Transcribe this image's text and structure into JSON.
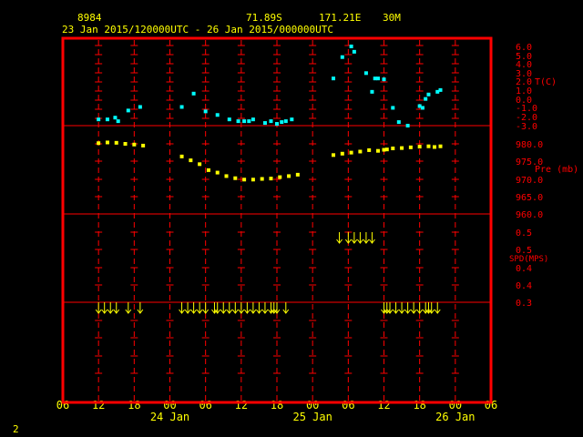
{
  "header": {
    "station_id": "8984",
    "latitude": "71.89S",
    "longitude": "171.21E",
    "elevation": "30M",
    "period": "23 Jan 2015/120000UTC - 26 Jan 2015/000000UTC"
  },
  "page_number": "2",
  "colors": {
    "background": "#000000",
    "frame": "#ff0000",
    "grid": "#ff0000",
    "header_text": "#ffff00",
    "temperature": "#00ffff",
    "pressure": "#ffff00",
    "wind": "#ffff00"
  },
  "chart_data": [
    {
      "type": "scatter",
      "ylabel": "T(C)",
      "ylim": [
        -3.0,
        6.0
      ],
      "yticks": [
        "6.0",
        "5.0",
        "4.0",
        "3.0",
        "2.0",
        "1.0",
        "0.0",
        "-1.0",
        "-2.0",
        "-3.0"
      ],
      "ytick_values": [
        6,
        5,
        4,
        3,
        2,
        1,
        0,
        -1,
        -2,
        -3
      ],
      "series": [
        {
          "x": [
            12,
            13.5,
            14.8,
            15.3,
            17,
            19,
            26,
            28,
            30,
            32,
            34,
            35.5,
            36.5,
            37.3,
            38,
            40,
            41,
            42,
            42.8,
            43.5,
            44.5,
            51.5,
            53,
            54.5,
            55,
            57,
            58,
            58.5,
            59,
            60,
            61.5,
            62.5,
            64,
            66,
            66.5,
            67,
            67.5,
            69,
            69.5
          ],
          "y": [
            -2.3,
            -2.3,
            -2.1,
            -2.5,
            -1.3,
            -0.9,
            -0.9,
            0.6,
            -1.4,
            -1.8,
            -2.3,
            -2.5,
            -2.5,
            -2.5,
            -2.3,
            -2.7,
            -2.5,
            -2.8,
            -2.6,
            -2.5,
            -2.3,
            2.3,
            4.7,
            5.9,
            5.3,
            2.9,
            0.8,
            2.3,
            2.3,
            2.2,
            -1.0,
            -2.6,
            -3.0,
            -0.8,
            -1.0,
            0.0,
            0.5,
            0.8,
            1.0
          ]
        }
      ]
    },
    {
      "type": "scatter",
      "ylabel": "Pre (mb)",
      "ylim": [
        960.0,
        980.0
      ],
      "yticks": [
        "980.0",
        "975.0",
        "970.0",
        "965.0",
        "960.0"
      ],
      "ytick_values": [
        980,
        975,
        970,
        965,
        960
      ],
      "series": [
        {
          "x": [
            12,
            13.5,
            15,
            16.5,
            18,
            19.5,
            26,
            27.5,
            29,
            30.5,
            32,
            33.5,
            35,
            36.5,
            38,
            39.5,
            41,
            42.5,
            44,
            45.5,
            51.5,
            53,
            54.5,
            56,
            57.5,
            59,
            60,
            60.5,
            61.5,
            63,
            64.5,
            66,
            67.5,
            68.5,
            69.5
          ],
          "y": [
            980.2,
            980.4,
            980.3,
            980.0,
            979.8,
            979.5,
            976.4,
            975.3,
            974.2,
            972.5,
            971.8,
            970.8,
            970.2,
            969.8,
            969.8,
            970.0,
            970.1,
            970.5,
            970.8,
            971.2,
            976.8,
            977.2,
            977.5,
            977.8,
            978.2,
            978.0,
            978.3,
            978.4,
            978.7,
            978.8,
            979.0,
            979.2,
            979.3,
            979.1,
            979.3
          ]
        }
      ]
    },
    {
      "type": "scatter",
      "ylabel": "SPD(MPS)",
      "ylim": [
        0.3,
        0.5
      ],
      "yticks": [
        "0.5",
        "0.5",
        "0.4",
        "0.4",
        "0.3",
        "0.3"
      ],
      "series": [
        {
          "marker": "arrow",
          "x": [
            12,
            13,
            14,
            15,
            17,
            19,
            26,
            27,
            28,
            29,
            30,
            31.5,
            32,
            33,
            34,
            35,
            36,
            37,
            38,
            39,
            40,
            41,
            41.5,
            42,
            43.5,
            52.5,
            54,
            55,
            56,
            57,
            58,
            60,
            60.5,
            61,
            62,
            63,
            64,
            65,
            66,
            67,
            67.5,
            68,
            69
          ],
          "y": [
            0.3,
            0.3,
            0.3,
            0.3,
            0.3,
            0.3,
            0.3,
            0.3,
            0.3,
            0.3,
            0.3,
            0.3,
            0.3,
            0.3,
            0.3,
            0.3,
            0.3,
            0.3,
            0.3,
            0.3,
            0.3,
            0.3,
            0.3,
            0.3,
            0.3,
            0.5,
            0.5,
            0.5,
            0.5,
            0.5,
            0.5,
            0.3,
            0.3,
            0.3,
            0.3,
            0.3,
            0.3,
            0.3,
            0.3,
            0.3,
            0.3,
            0.3,
            0.3
          ]
        }
      ]
    }
  ],
  "x_axis": {
    "range_hours": [
      6,
      78
    ],
    "tick_hours": [
      6,
      12,
      18,
      24,
      30,
      36,
      42,
      48,
      54,
      60,
      66,
      72,
      78
    ],
    "tick_labels": [
      "06",
      "12",
      "18",
      "00",
      "06",
      "12",
      "18",
      "00",
      "06",
      "12",
      "18",
      "00",
      "06"
    ],
    "date_labels": [
      {
        "text": "24 Jan",
        "hour": 24
      },
      {
        "text": "25 Jan",
        "hour": 48
      },
      {
        "text": "26 Jan",
        "hour": 72
      }
    ]
  }
}
